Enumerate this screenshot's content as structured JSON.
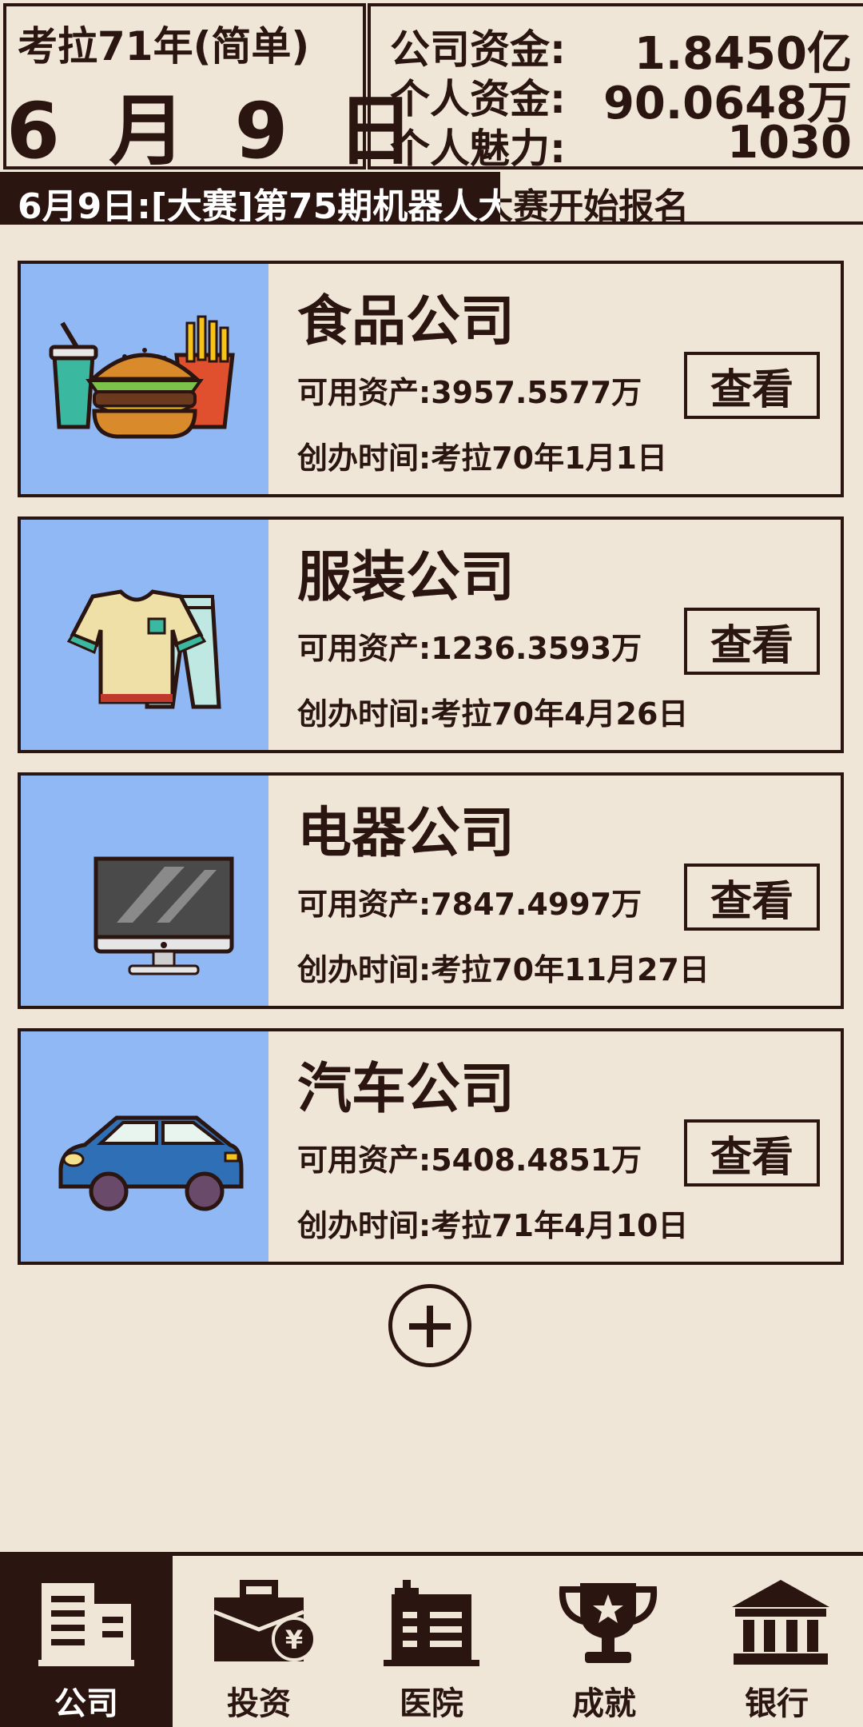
{
  "header": {
    "year_mode": "考拉71年(简单)",
    "date": "6 月 9 日",
    "funds": [
      {
        "label": "公司资金:",
        "value": "1.8450亿"
      },
      {
        "label": "个人资金:",
        "value": "90.0648万"
      },
      {
        "label": "个人魅力:",
        "value": "1030"
      }
    ]
  },
  "ticker": {
    "text": "6月9日:[大赛]第75期机器人大赛开始报名",
    "progress_fraction": 0.58
  },
  "companies": [
    {
      "name": "食品公司",
      "assets": "可用资产:3957.5577万",
      "founded": "创办时间:考拉70年1月1日",
      "button": "查看",
      "icon": "fast-food-icon"
    },
    {
      "name": "服装公司",
      "assets": "可用资产:1236.3593万",
      "founded": "创办时间:考拉70年4月26日",
      "button": "查看",
      "icon": "clothing-icon"
    },
    {
      "name": "电器公司",
      "assets": "可用资产:7847.4997万",
      "founded": "创办时间:考拉70年11月27日",
      "button": "查看",
      "icon": "monitor-icon"
    },
    {
      "name": "汽车公司",
      "assets": "可用资产:5408.4851万",
      "founded": "创办时间:考拉71年4月10日",
      "button": "查看",
      "icon": "car-icon"
    }
  ],
  "nav": [
    {
      "label": "公司",
      "icon": "office-building-icon",
      "active": true
    },
    {
      "label": "投资",
      "icon": "briefcase-yen-icon",
      "active": false
    },
    {
      "label": "医院",
      "icon": "hospital-icon",
      "active": false
    },
    {
      "label": "成就",
      "icon": "trophy-icon",
      "active": false
    },
    {
      "label": "银行",
      "icon": "bank-icon",
      "active": false
    }
  ],
  "colors": {
    "background": "#efe6d8",
    "dark": "#2a1510",
    "card_image_bg": "#8fb8f5"
  }
}
